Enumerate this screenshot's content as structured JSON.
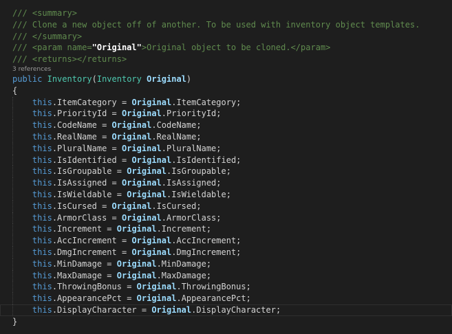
{
  "doc": {
    "l1": "/// <summary>",
    "l2": "/// Clone a new object off of another. To be used with inventory object templates.",
    "l3": "/// </summary>",
    "l4_pre": "/// <param name=",
    "l4_val": "\"Original\"",
    "l4_post": ">Original object to be cloned.</param>",
    "l5": "/// <returns></returns>"
  },
  "codelens": "3 references",
  "signature": {
    "modifier": "public",
    "type": "Inventory",
    "open": "(",
    "param_type": "Inventory",
    "param_name": "Original",
    "close": ")"
  },
  "brace_open": "{",
  "brace_close": "}",
  "this_kw": "this",
  "source_obj": "Original",
  "assignments": [
    "ItemCategory",
    "PriorityId",
    "CodeName",
    "RealName",
    "PluralName",
    "IsIdentified",
    "IsGroupable",
    "IsAssigned",
    "IsWieldable",
    "IsCursed",
    "ArmorClass",
    "Increment",
    "AccIncrement",
    "DmgIncrement",
    "MinDamage",
    "MaxDamage",
    "ThrowingBonus",
    "AppearancePct",
    "DisplayCharacter"
  ],
  "colors": {
    "background": "#1e1e1e",
    "comment": "#608b4e",
    "keyword": "#569cd6",
    "type": "#4ec9b0",
    "parameter": "#9cdcfe",
    "text": "#d4d4d4"
  }
}
